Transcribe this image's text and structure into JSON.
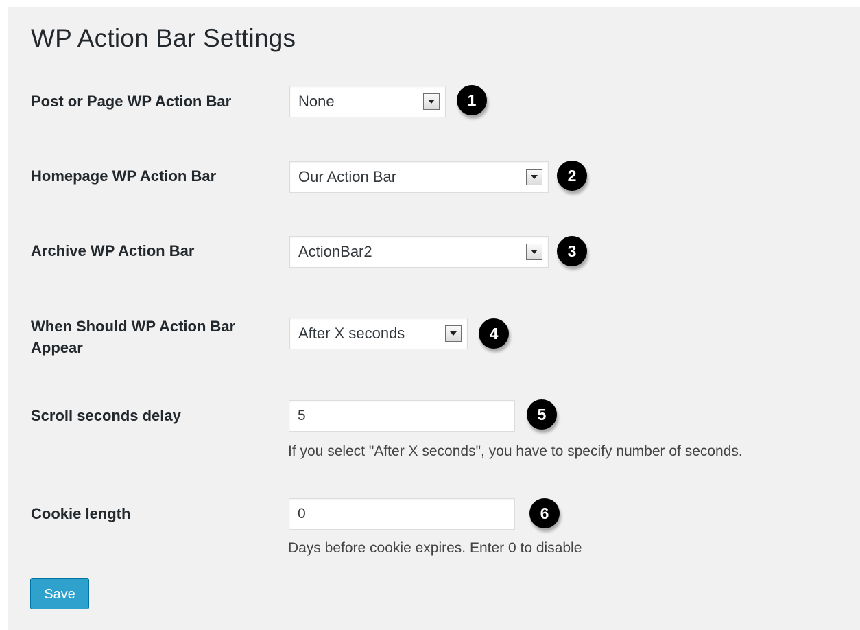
{
  "page": {
    "title": "WP Action Bar Settings"
  },
  "settings": [
    {
      "label": "Post or Page WP Action Bar",
      "value": "None",
      "marker": "1"
    },
    {
      "label": "Homepage WP Action Bar",
      "value": "Our Action Bar",
      "marker": "2"
    },
    {
      "label": "Archive WP Action Bar",
      "value": "ActionBar2",
      "marker": "3"
    },
    {
      "label": "When Should WP Action Bar Appear",
      "value": "After X seconds",
      "marker": "4"
    },
    {
      "label": "Scroll seconds delay",
      "value": "5",
      "marker": "5",
      "hint": "If you select \"After X seconds\", you have to specify number of seconds."
    },
    {
      "label": "Cookie length",
      "value": "0",
      "marker": "6",
      "hint": "Days before cookie expires. Enter 0 to disable"
    }
  ],
  "actions": {
    "save_label": "Save"
  },
  "colors": {
    "background": "#f1f1f1",
    "save_button": "#2ea2cc",
    "marker": "#000000"
  },
  "icons": {
    "select_arrow": "chevron-down-icon"
  }
}
